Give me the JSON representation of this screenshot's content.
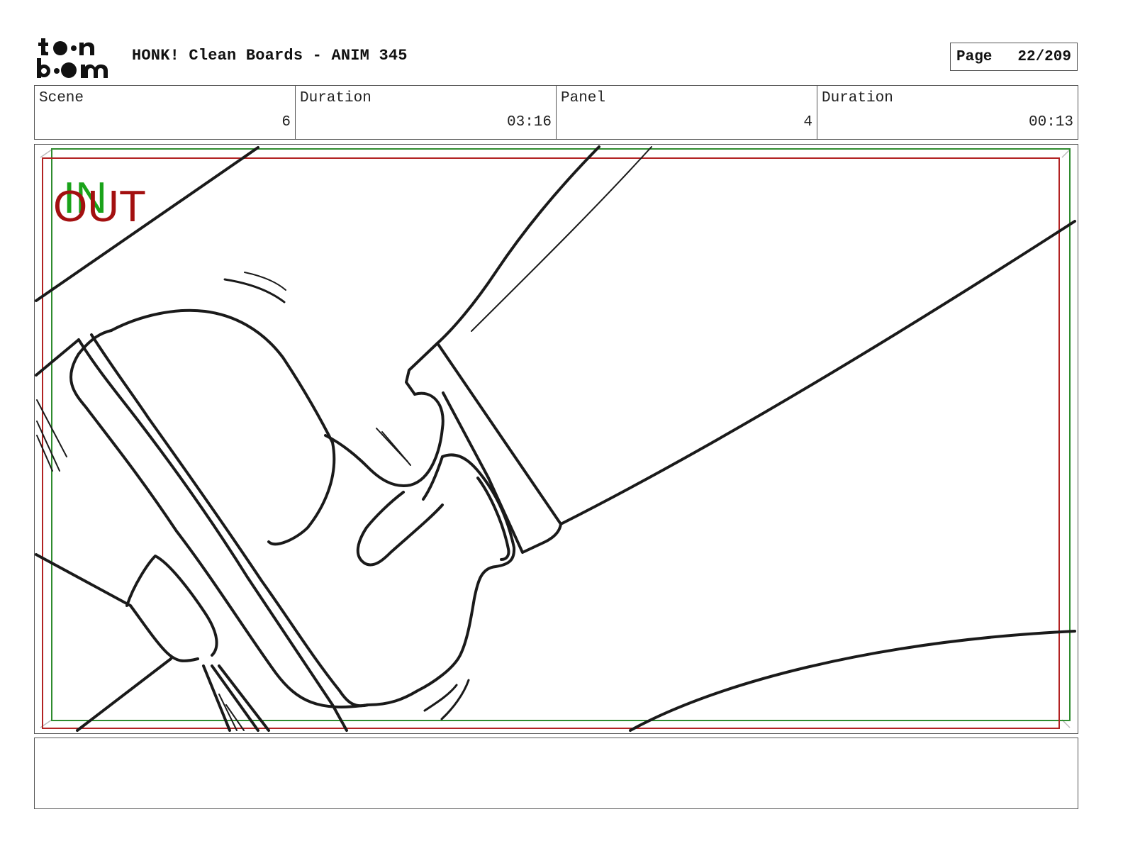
{
  "header": {
    "logo_line1": "toon",
    "logo_line2": "boom",
    "title": "HONK! Clean Boards - ANIM 345",
    "page_label": "Page",
    "page_value": "22/209"
  },
  "info": {
    "scene_label": "Scene",
    "scene_value": "6",
    "scene_duration_label": "Duration",
    "scene_duration_value": "03:16",
    "panel_label": "Panel",
    "panel_value": "4",
    "panel_duration_label": "Duration",
    "panel_duration_value": "00:13"
  },
  "panel": {
    "in_label": "IN",
    "out_label": "OUT",
    "in_color": "#1aa31a",
    "out_color": "#a31010",
    "safe_frame_green": "#2e8b2e",
    "safe_frame_red": "#b22222"
  },
  "notes": {
    "text": ""
  }
}
